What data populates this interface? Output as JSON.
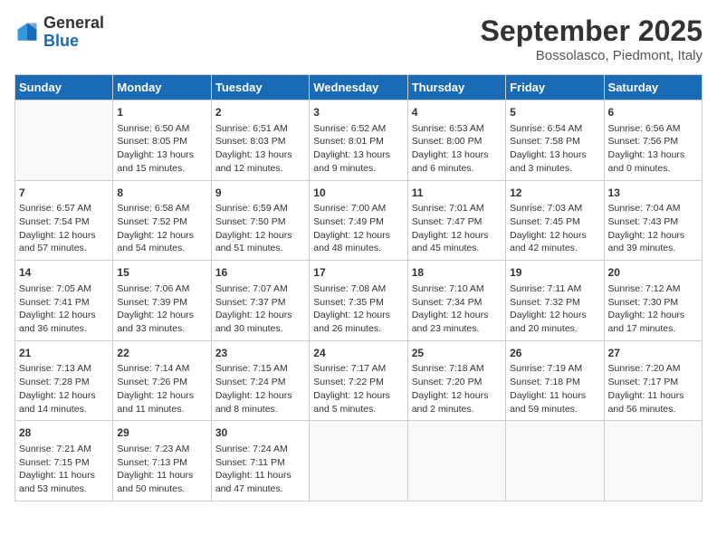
{
  "logo": {
    "line1": "General",
    "line2": "Blue"
  },
  "title": "September 2025",
  "location": "Bossolasco, Piedmont, Italy",
  "weekdays": [
    "Sunday",
    "Monday",
    "Tuesday",
    "Wednesday",
    "Thursday",
    "Friday",
    "Saturday"
  ],
  "weeks": [
    [
      {
        "day": "",
        "info": ""
      },
      {
        "day": "1",
        "info": "Sunrise: 6:50 AM\nSunset: 8:05 PM\nDaylight: 13 hours\nand 15 minutes."
      },
      {
        "day": "2",
        "info": "Sunrise: 6:51 AM\nSunset: 8:03 PM\nDaylight: 13 hours\nand 12 minutes."
      },
      {
        "day": "3",
        "info": "Sunrise: 6:52 AM\nSunset: 8:01 PM\nDaylight: 13 hours\nand 9 minutes."
      },
      {
        "day": "4",
        "info": "Sunrise: 6:53 AM\nSunset: 8:00 PM\nDaylight: 13 hours\nand 6 minutes."
      },
      {
        "day": "5",
        "info": "Sunrise: 6:54 AM\nSunset: 7:58 PM\nDaylight: 13 hours\nand 3 minutes."
      },
      {
        "day": "6",
        "info": "Sunrise: 6:56 AM\nSunset: 7:56 PM\nDaylight: 13 hours\nand 0 minutes."
      }
    ],
    [
      {
        "day": "7",
        "info": "Sunrise: 6:57 AM\nSunset: 7:54 PM\nDaylight: 12 hours\nand 57 minutes."
      },
      {
        "day": "8",
        "info": "Sunrise: 6:58 AM\nSunset: 7:52 PM\nDaylight: 12 hours\nand 54 minutes."
      },
      {
        "day": "9",
        "info": "Sunrise: 6:59 AM\nSunset: 7:50 PM\nDaylight: 12 hours\nand 51 minutes."
      },
      {
        "day": "10",
        "info": "Sunrise: 7:00 AM\nSunset: 7:49 PM\nDaylight: 12 hours\nand 48 minutes."
      },
      {
        "day": "11",
        "info": "Sunrise: 7:01 AM\nSunset: 7:47 PM\nDaylight: 12 hours\nand 45 minutes."
      },
      {
        "day": "12",
        "info": "Sunrise: 7:03 AM\nSunset: 7:45 PM\nDaylight: 12 hours\nand 42 minutes."
      },
      {
        "day": "13",
        "info": "Sunrise: 7:04 AM\nSunset: 7:43 PM\nDaylight: 12 hours\nand 39 minutes."
      }
    ],
    [
      {
        "day": "14",
        "info": "Sunrise: 7:05 AM\nSunset: 7:41 PM\nDaylight: 12 hours\nand 36 minutes."
      },
      {
        "day": "15",
        "info": "Sunrise: 7:06 AM\nSunset: 7:39 PM\nDaylight: 12 hours\nand 33 minutes."
      },
      {
        "day": "16",
        "info": "Sunrise: 7:07 AM\nSunset: 7:37 PM\nDaylight: 12 hours\nand 30 minutes."
      },
      {
        "day": "17",
        "info": "Sunrise: 7:08 AM\nSunset: 7:35 PM\nDaylight: 12 hours\nand 26 minutes."
      },
      {
        "day": "18",
        "info": "Sunrise: 7:10 AM\nSunset: 7:34 PM\nDaylight: 12 hours\nand 23 minutes."
      },
      {
        "day": "19",
        "info": "Sunrise: 7:11 AM\nSunset: 7:32 PM\nDaylight: 12 hours\nand 20 minutes."
      },
      {
        "day": "20",
        "info": "Sunrise: 7:12 AM\nSunset: 7:30 PM\nDaylight: 12 hours\nand 17 minutes."
      }
    ],
    [
      {
        "day": "21",
        "info": "Sunrise: 7:13 AM\nSunset: 7:28 PM\nDaylight: 12 hours\nand 14 minutes."
      },
      {
        "day": "22",
        "info": "Sunrise: 7:14 AM\nSunset: 7:26 PM\nDaylight: 12 hours\nand 11 minutes."
      },
      {
        "day": "23",
        "info": "Sunrise: 7:15 AM\nSunset: 7:24 PM\nDaylight: 12 hours\nand 8 minutes."
      },
      {
        "day": "24",
        "info": "Sunrise: 7:17 AM\nSunset: 7:22 PM\nDaylight: 12 hours\nand 5 minutes."
      },
      {
        "day": "25",
        "info": "Sunrise: 7:18 AM\nSunset: 7:20 PM\nDaylight: 12 hours\nand 2 minutes."
      },
      {
        "day": "26",
        "info": "Sunrise: 7:19 AM\nSunset: 7:18 PM\nDaylight: 11 hours\nand 59 minutes."
      },
      {
        "day": "27",
        "info": "Sunrise: 7:20 AM\nSunset: 7:17 PM\nDaylight: 11 hours\nand 56 minutes."
      }
    ],
    [
      {
        "day": "28",
        "info": "Sunrise: 7:21 AM\nSunset: 7:15 PM\nDaylight: 11 hours\nand 53 minutes."
      },
      {
        "day": "29",
        "info": "Sunrise: 7:23 AM\nSunset: 7:13 PM\nDaylight: 11 hours\nand 50 minutes."
      },
      {
        "day": "30",
        "info": "Sunrise: 7:24 AM\nSunset: 7:11 PM\nDaylight: 11 hours\nand 47 minutes."
      },
      {
        "day": "",
        "info": ""
      },
      {
        "day": "",
        "info": ""
      },
      {
        "day": "",
        "info": ""
      },
      {
        "day": "",
        "info": ""
      }
    ]
  ]
}
